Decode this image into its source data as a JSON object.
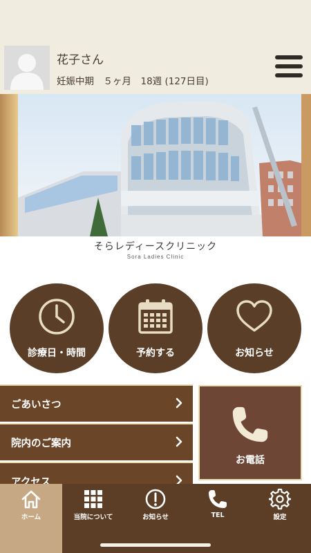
{
  "profile": {
    "name": "花子さん",
    "status": "妊娠中期　５ヶ月　18週 (127日目)"
  },
  "banner": {
    "logo_main": "そらレディースクリニック",
    "logo_sub": "Sora Ladies Clinic"
  },
  "quick_actions": [
    {
      "label": "診療日・時間",
      "icon": "clock-icon"
    },
    {
      "label": "予約する",
      "icon": "calendar-icon"
    },
    {
      "label": "お知らせ",
      "icon": "heart-icon"
    }
  ],
  "menu_list": [
    {
      "label": "ごあいさつ"
    },
    {
      "label": "院内のご案内"
    },
    {
      "label": "アクセス"
    }
  ],
  "phone_tile": {
    "label": "お電話",
    "icon": "phone-icon"
  },
  "bottom_nav": [
    {
      "label": "ホーム",
      "icon": "home-icon",
      "active": true
    },
    {
      "label": "当院について",
      "icon": "grid-icon",
      "active": false
    },
    {
      "label": "お知らせ",
      "icon": "info-icon",
      "active": false
    },
    {
      "label": "TEL",
      "icon": "phone-icon",
      "active": false
    },
    {
      "label": "設定",
      "icon": "gear-icon",
      "active": false
    }
  ],
  "colors": {
    "header_bg": "#f0ede0",
    "brown_dark": "#5a3e27",
    "menu_brown": "#6b4528",
    "nav_bg": "#5c3e26",
    "nav_active": "#c6a984",
    "accent_line": "#e8dfb2"
  }
}
